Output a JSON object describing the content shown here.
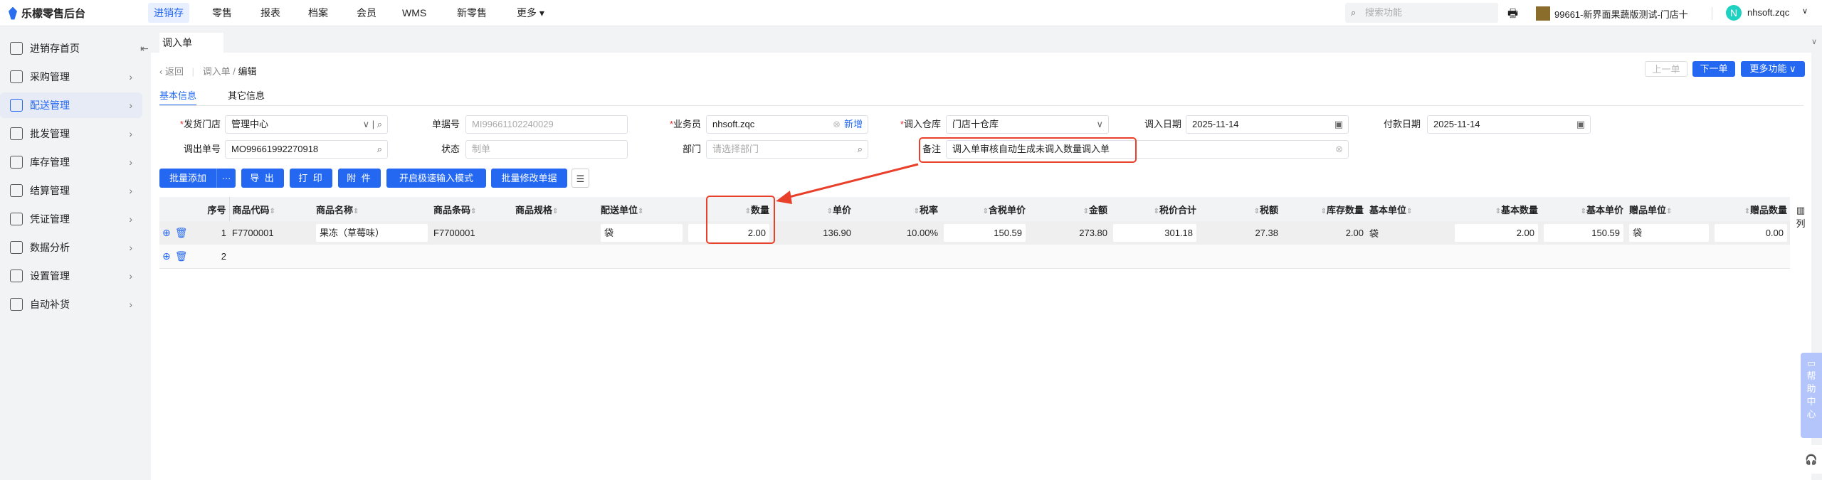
{
  "app": {
    "title": "乐檬零售后台",
    "nav": [
      "进销存",
      "零售",
      "报表",
      "档案",
      "会员",
      "WMS",
      "新零售",
      "更多"
    ],
    "search_placeholder": "搜索功能",
    "store": "99661-新界面果蔬版测试-门店十",
    "user_initial": "N",
    "user": "nhsoft.zqc"
  },
  "sidebar": {
    "items": [
      {
        "label": "进销存首页",
        "icon": "home-icon"
      },
      {
        "label": "采购管理",
        "icon": "cart-icon"
      },
      {
        "label": "配送管理",
        "icon": "map-icon"
      },
      {
        "label": "批发管理",
        "icon": "cabinet-icon"
      },
      {
        "label": "库存管理",
        "icon": "box-icon"
      },
      {
        "label": "结算管理",
        "icon": "dollar-icon"
      },
      {
        "label": "凭证管理",
        "icon": "document-icon"
      },
      {
        "label": "数据分析",
        "icon": "chart-icon"
      },
      {
        "label": "设置管理",
        "icon": "settings-icon"
      },
      {
        "label": "自动补货",
        "icon": "replenish-icon"
      }
    ],
    "active": "配送管理"
  },
  "page_tab": "调入单",
  "breadcrumb": {
    "back": "返回",
    "parent": "调入单",
    "sep": "/",
    "current": "编辑"
  },
  "top_buttons": {
    "prev": "上一单",
    "next": "下一单",
    "more": "更多功能"
  },
  "tabs": [
    "基本信息",
    "其它信息"
  ],
  "form": {
    "ship_store": {
      "label": "发货门店",
      "value": "管理中心"
    },
    "doc_no": {
      "label": "单据号",
      "value": "MI99661102240029"
    },
    "salesman": {
      "label": "业务员",
      "value": "nhsoft.zqc",
      "add": "新增"
    },
    "in_warehouse": {
      "label": "调入仓库",
      "value": "门店十仓库"
    },
    "in_date": {
      "label": "调入日期",
      "value": "2025-11-14"
    },
    "pay_date": {
      "label": "付款日期",
      "value": "2025-11-14"
    },
    "out_no": {
      "label": "调出单号",
      "value": "MO99661992270918"
    },
    "status": {
      "label": "状态",
      "value": "制单"
    },
    "dept": {
      "label": "部门",
      "placeholder": "请选择部门"
    },
    "remark": {
      "label": "备注",
      "value": "调入单审核自动生成未调入数量调入单"
    }
  },
  "toolbar": {
    "batch_add": "批量添加",
    "more": "···",
    "export": "导 出",
    "print": "打 印",
    "attach": "附 件",
    "fast_input": "开启极速输入模式",
    "batch_edit": "批量修改单据"
  },
  "table": {
    "columns": [
      "序号",
      "商品代码",
      "商品名称",
      "商品条码",
      "商品规格",
      "配送单位",
      "数量",
      "单价",
      "税率",
      "含税单价",
      "金额",
      "税价合计",
      "税额",
      "库存数量",
      "基本单位",
      "基本数量",
      "基本单价",
      "赠品单位",
      "赠品数量"
    ],
    "rows": [
      {
        "no": "1",
        "code": "F7700001",
        "name": "果冻（草莓味）",
        "barcode": "F7700001",
        "spec": "",
        "unit": "袋",
        "qty": "2.00",
        "price": "136.90",
        "tax_rate": "10.00%",
        "tax_price": "150.59",
        "amount": "273.80",
        "total": "301.18",
        "tax": "27.38",
        "stock": "2.00",
        "base_unit": "袋",
        "base_qty": "2.00",
        "base_price": "150.59",
        "gift_unit": "袋",
        "gift_qty": "0.00"
      },
      {
        "no": "2"
      }
    ],
    "col_settings": "列"
  },
  "help": "帮助中心"
}
